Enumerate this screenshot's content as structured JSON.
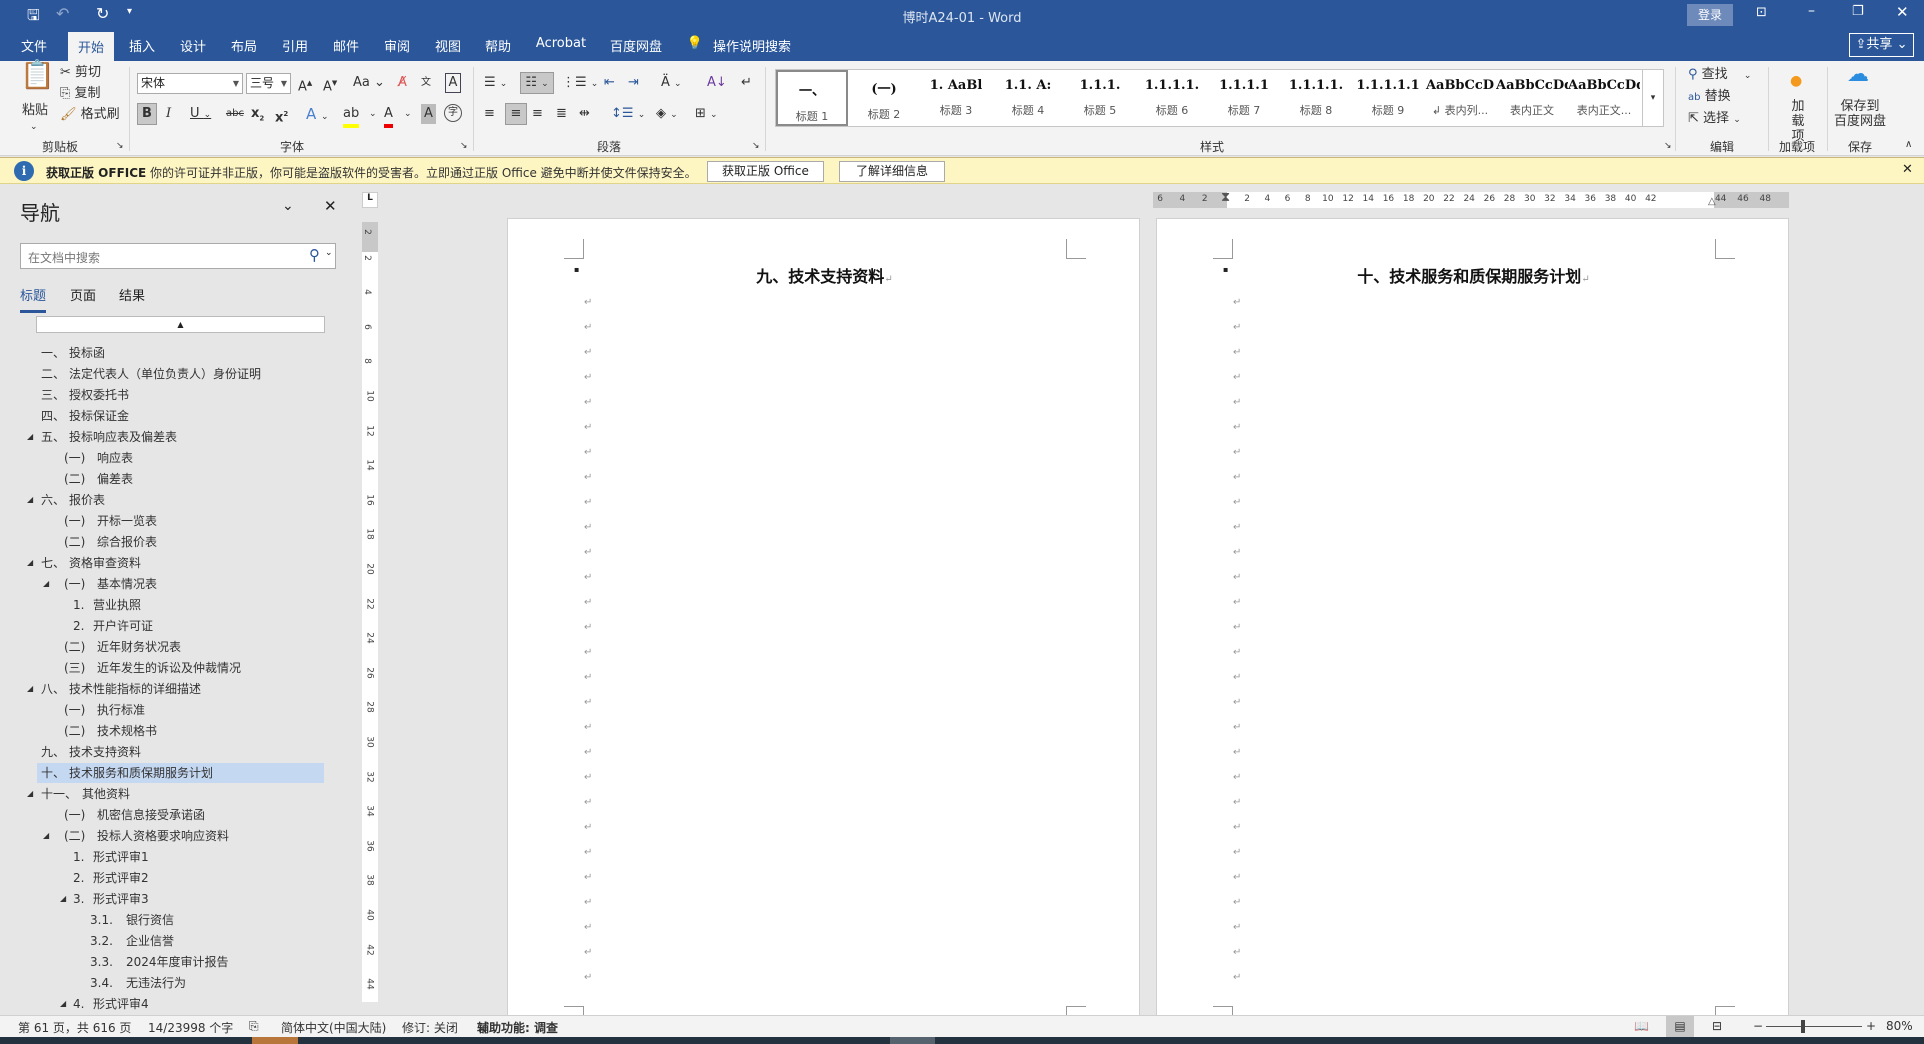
{
  "titlebar": {
    "title": "博时A24-01  -  Word",
    "login": "登录",
    "qat": {
      "save": "save-icon",
      "undo": "↶",
      "redo": "↻",
      "customize": "▾"
    }
  },
  "tabs": [
    {
      "label": "文件"
    },
    {
      "label": "开始",
      "active": true
    },
    {
      "label": "插入"
    },
    {
      "label": "设计"
    },
    {
      "label": "布局"
    },
    {
      "label": "引用"
    },
    {
      "label": "邮件"
    },
    {
      "label": "审阅"
    },
    {
      "label": "视图"
    },
    {
      "label": "帮助"
    },
    {
      "label": "Acrobat"
    },
    {
      "label": "百度网盘"
    }
  ],
  "tell_me": "操作说明搜索",
  "share": "共享",
  "ribbon": {
    "clipboard": {
      "label": "剪贴板",
      "paste": "粘贴",
      "cut": "剪切",
      "copy": "复制",
      "format_painter": "格式刷"
    },
    "font": {
      "label": "字体",
      "font_name": "宋体",
      "font_size": "三号"
    },
    "paragraph": {
      "label": "段落"
    },
    "styles": {
      "label": "样式",
      "items": [
        {
          "preview": "一、",
          "label": "标题 1"
        },
        {
          "preview": "(一)",
          "label": "标题 2"
        },
        {
          "preview": "1.  AaBl",
          "label": "标题 3"
        },
        {
          "preview": "1.1.  A:",
          "label": "标题 4"
        },
        {
          "preview": "1.1.1.",
          "label": "标题 5"
        },
        {
          "preview": "1.1.1.1.",
          "label": "标题 6"
        },
        {
          "preview": "1.1.1.1",
          "label": "标题 7"
        },
        {
          "preview": "1.1.1.1.",
          "label": "标题 8"
        },
        {
          "preview": "1.1.1.1.1",
          "label": "标题 9"
        },
        {
          "preview": "AaBbCcD",
          "label": "↲ 表内列..."
        },
        {
          "preview": "AaBbCcDdI",
          "label": "表内正文"
        },
        {
          "preview": "AaBbCcDdI",
          "label": "表内正文..."
        }
      ]
    },
    "editing": {
      "label": "编辑",
      "find": "查找",
      "replace": "替换",
      "select": "选择"
    },
    "addins": {
      "label": "加载项",
      "button": "加\n载项"
    },
    "save": {
      "label": "保存",
      "button_line1": "保存到",
      "button_line2": "百度网盘"
    }
  },
  "license_bar": {
    "title": "获取正版 OFFICE",
    "message": "你的许可证并非正版，你可能是盗版软件的受害者。立即通过正版 Office 避免中断并使文件保持安全。",
    "btn_genuine": "获取正版 Office",
    "btn_learn": "了解详细信息"
  },
  "nav": {
    "title": "导航",
    "search_placeholder": "在文档中搜索",
    "tabs": [
      "标题",
      "页面",
      "结果"
    ],
    "items": [
      {
        "num": "一、",
        "text": "投标函",
        "level": 1
      },
      {
        "num": "二、",
        "text": "法定代表人（单位负责人）身份证明",
        "level": 1
      },
      {
        "num": "三、",
        "text": "授权委托书",
        "level": 1
      },
      {
        "num": "四、",
        "text": "投标保证金",
        "level": 1
      },
      {
        "num": "五、",
        "text": "投标响应表及偏差表",
        "level": 1,
        "expanded": true
      },
      {
        "num": "(一)",
        "text": "响应表",
        "level": 2
      },
      {
        "num": "(二)",
        "text": "偏差表",
        "level": 2
      },
      {
        "num": "六、",
        "text": "报价表",
        "level": 1,
        "expanded": true
      },
      {
        "num": "(一)",
        "text": "开标一览表",
        "level": 2
      },
      {
        "num": "(二)",
        "text": "综合报价表",
        "level": 2
      },
      {
        "num": "七、",
        "text": "资格审查资料",
        "level": 1,
        "expanded": true
      },
      {
        "num": "(一)",
        "text": "基本情况表",
        "level": 2,
        "expanded": true
      },
      {
        "num": "1.",
        "text": "营业执照",
        "level": 3
      },
      {
        "num": "2.",
        "text": "开户许可证",
        "level": 3
      },
      {
        "num": "(二)",
        "text": "近年财务状况表",
        "level": 2
      },
      {
        "num": "(三)",
        "text": "近年发生的诉讼及仲裁情况",
        "level": 2
      },
      {
        "num": "八、",
        "text": "技术性能指标的详细描述",
        "level": 1,
        "expanded": true
      },
      {
        "num": "(一)",
        "text": "执行标准",
        "level": 2
      },
      {
        "num": "(二)",
        "text": "技术规格书",
        "level": 2
      },
      {
        "num": "九、",
        "text": "技术支持资料",
        "level": 1
      },
      {
        "num": "十、",
        "text": "技术服务和质保期服务计划",
        "level": 1,
        "selected": true
      },
      {
        "num": "十一、",
        "text": "其他资料",
        "level": 1,
        "expanded": true
      },
      {
        "num": "(一)",
        "text": "机密信息接受承诺函",
        "level": 2
      },
      {
        "num": "(二)",
        "text": "投标人资格要求响应资料",
        "level": 2,
        "expanded": true
      },
      {
        "num": "1.",
        "text": "形式评审1",
        "level": 3
      },
      {
        "num": "2.",
        "text": "形式评审2",
        "level": 3
      },
      {
        "num": "3.",
        "text": "形式评审3",
        "level": 3,
        "expanded": true
      },
      {
        "num": "3.1.",
        "text": "银行资信",
        "level": 4
      },
      {
        "num": "3.2.",
        "text": "企业信誉",
        "level": 4
      },
      {
        "num": "3.3.",
        "text": "2024年度审计报告",
        "level": 4
      },
      {
        "num": "3.4.",
        "text": "无违法行为",
        "level": 4
      },
      {
        "num": "4.",
        "text": "形式评审4",
        "level": 3,
        "expanded": true
      }
    ]
  },
  "rulers": {
    "horizontal_left": [
      "6",
      "4",
      "2"
    ],
    "horizontal": [
      "2",
      "4",
      "6",
      "8",
      "10",
      "12",
      "14",
      "16",
      "18",
      "20",
      "22",
      "24",
      "26",
      "28",
      "30",
      "32",
      "34",
      "36",
      "38",
      "40",
      "42"
    ],
    "horizontal_right": [
      "44",
      "46",
      "48"
    ],
    "vertical": [
      "2",
      "2",
      "4",
      "6",
      "8",
      "10",
      "12",
      "14",
      "16",
      "18",
      "20",
      "22",
      "24",
      "26",
      "28",
      "30",
      "32",
      "34",
      "36",
      "38",
      "40",
      "42",
      "44"
    ],
    "tab_selector": "L"
  },
  "document": {
    "pages": [
      {
        "heading": "九、技术支持资料"
      },
      {
        "heading": "十、技术服务和质保期服务计划"
      }
    ],
    "para_mark": "↵",
    "bullet": "▪"
  },
  "status": {
    "page": "第 61 页，共 616 页",
    "words": "14/23998 个字",
    "language": "简体中文(中国大陆)",
    "track": "修订: 关闭",
    "accessibility": "辅助功能: 调查",
    "zoom": "80%",
    "zoom_level_percent": 80
  },
  "colors": {
    "brand": "#2b579a",
    "license_bar": "#fdf6c3",
    "selection": "#c5d8f2"
  }
}
